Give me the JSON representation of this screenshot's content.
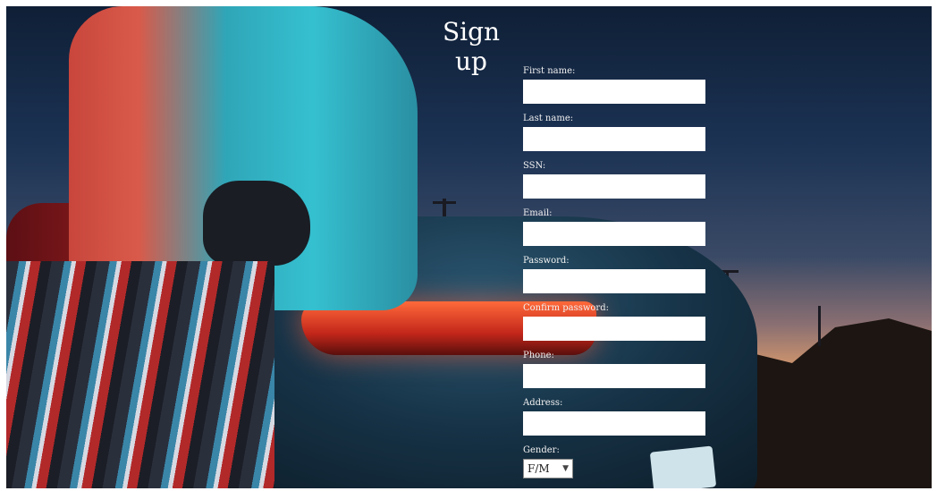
{
  "page": {
    "title": "Sign up"
  },
  "form": {
    "fields": [
      {
        "label": "First name:",
        "value": ""
      },
      {
        "label": "Last name:",
        "value": ""
      },
      {
        "label": "SSN:",
        "value": ""
      },
      {
        "label": "Email:",
        "value": ""
      },
      {
        "label": "Password:",
        "value": ""
      },
      {
        "label": "Confirm password:",
        "value": ""
      },
      {
        "label": "Phone:",
        "value": ""
      },
      {
        "label": "Address:",
        "value": ""
      }
    ],
    "gender": {
      "label": "Gender:",
      "selected": "F/M"
    }
  },
  "icons": {
    "gender_dropdown": "chevron-down-icon"
  }
}
